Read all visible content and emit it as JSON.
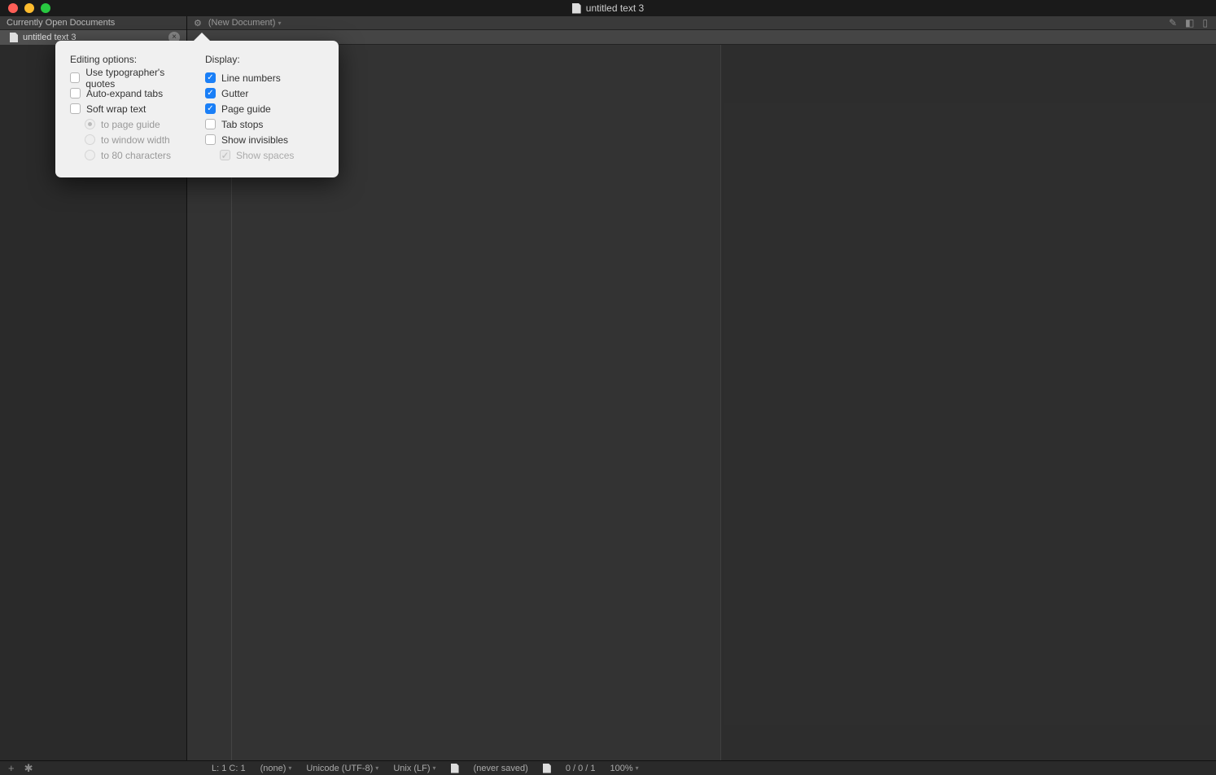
{
  "title": "untitled text 3",
  "sidebar": {
    "header": "Currently Open Documents",
    "items": [
      {
        "label": "untitled text 3"
      }
    ]
  },
  "toolbar": {
    "docType": "(New Document)"
  },
  "popover": {
    "editing": {
      "heading": "Editing options:",
      "typographers": {
        "label": "Use typographer's quotes",
        "checked": false
      },
      "autoExpand": {
        "label": "Auto-expand tabs",
        "checked": false
      },
      "softWrap": {
        "label": "Soft wrap text",
        "checked": false
      },
      "wrapPageGuide": {
        "label": "to page guide",
        "selected": true
      },
      "wrapWindow": {
        "label": "to window width",
        "selected": false
      },
      "wrap80": {
        "label": "to 80 characters",
        "selected": false
      }
    },
    "display": {
      "heading": "Display:",
      "lineNumbers": {
        "label": "Line numbers",
        "checked": true
      },
      "gutter": {
        "label": "Gutter",
        "checked": true
      },
      "pageGuide": {
        "label": "Page guide",
        "checked": true
      },
      "tabStops": {
        "label": "Tab stops",
        "checked": false
      },
      "showInvisibles": {
        "label": "Show invisibles",
        "checked": false
      },
      "showSpaces": {
        "label": "Show spaces",
        "checked": true,
        "disabled": true
      }
    }
  },
  "status": {
    "cursor": "L: 1 C: 1",
    "language": "(none)",
    "encoding": "Unicode (UTF-8)",
    "lineEnding": "Unix (LF)",
    "savedState": "(never saved)",
    "counts": "0 / 0 / 1",
    "zoom": "100%"
  }
}
